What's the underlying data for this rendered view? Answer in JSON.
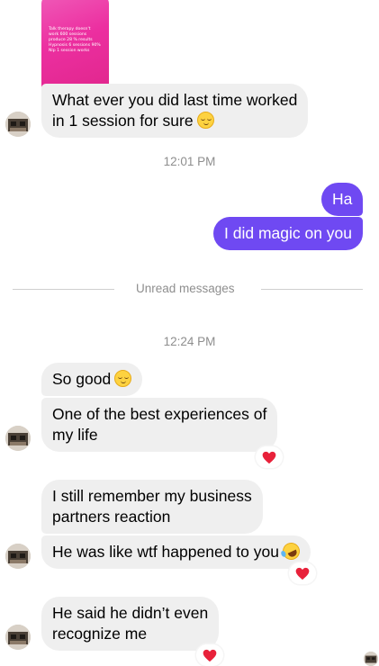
{
  "shared_post": {
    "lines": [
      "Talk therapy doesn't",
      "work 600 sessions",
      "produce 28 % results",
      "Hypnosis  6 sessions 90%",
      "Nlp  1 session works"
    ]
  },
  "messages": {
    "m1": "What ever you did last time worked",
    "m1b": "in 1 session for sure",
    "ts1": "12:01 PM",
    "s1": "Ha",
    "s2": "I did magic on you",
    "unread": "Unread messages",
    "ts2": "12:24 PM",
    "m2": "So good",
    "m3a": "One of the best experiences of",
    "m3b": "my life",
    "m4a": "I still remember my business",
    "m4b": "partners reaction",
    "m5": "He was like wtf happened to you",
    "m6a": "He said he didn’t even",
    "m6b": "recognize me"
  },
  "reactions": {
    "heart_icon": "red-heart-icon",
    "heart_color": "#e8213a"
  },
  "colors": {
    "sent_bubble": "#6f49f2",
    "received_bubble": "#efefef",
    "post_gradient": "#ec2fa0"
  }
}
